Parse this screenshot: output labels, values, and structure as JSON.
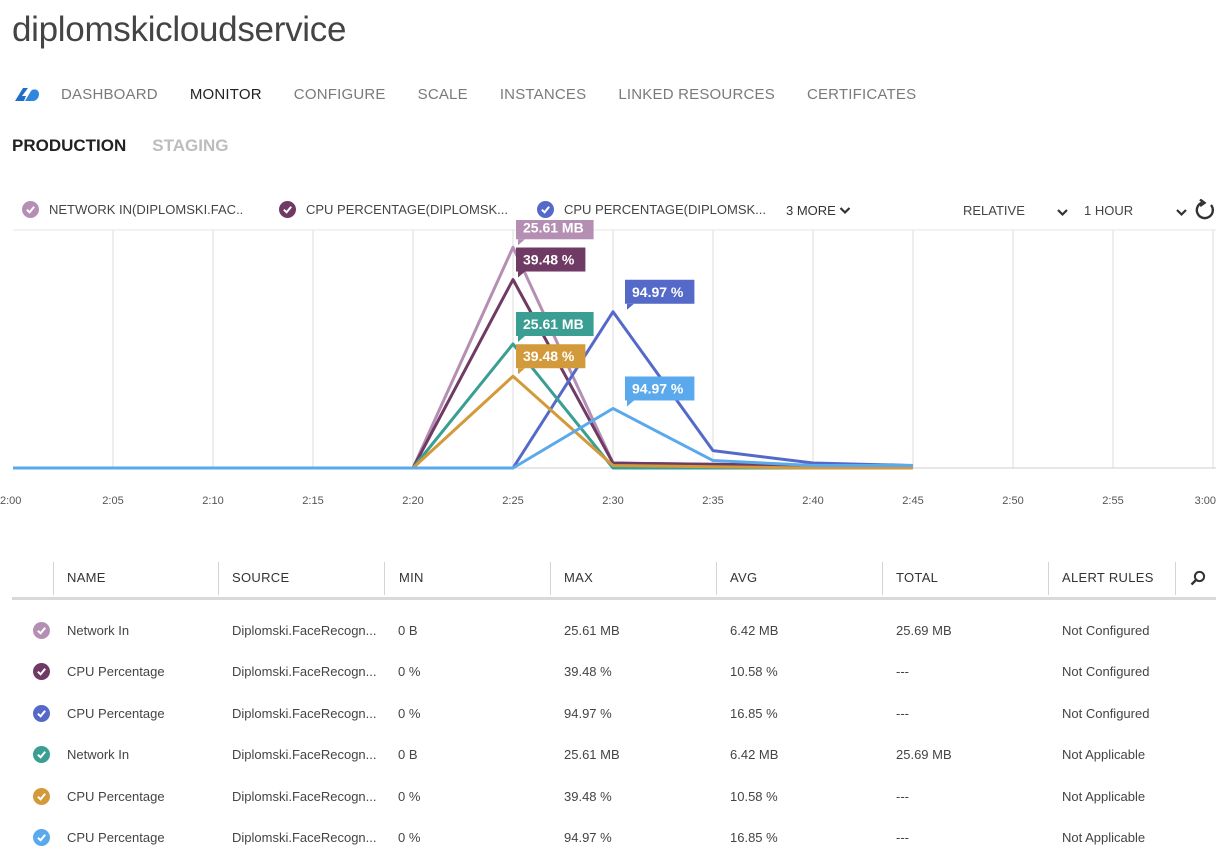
{
  "app": {
    "title": "diplomskicloudservice"
  },
  "nav": {
    "tabs": [
      "DASHBOARD",
      "MONITOR",
      "CONFIGURE",
      "SCALE",
      "INSTANCES",
      "LINKED RESOURCES",
      "CERTIFICATES"
    ],
    "active": "MONITOR"
  },
  "slots": {
    "production": "PRODUCTION",
    "staging": "STAGING"
  },
  "toolbar": {
    "legend": [
      {
        "label": "NETWORK IN(DIPLOMSKI.FAC..",
        "color": "#b48fb3"
      },
      {
        "label": "CPU PERCENTAGE(DIPLOMSK...",
        "color": "#6f3a63"
      },
      {
        "label": "CPU PERCENTAGE(DIPLOMSK...",
        "color": "#5569c9"
      }
    ],
    "more_label": "3 MORE",
    "mode_label": "RELATIVE",
    "range_label": "1 HOUR"
  },
  "chart_data": {
    "type": "line",
    "x": [
      "2:00",
      "2:05",
      "2:10",
      "2:15",
      "2:20",
      "2:25",
      "2:30",
      "2:35",
      "2:40",
      "2:45",
      "2:50",
      "2:55",
      "3:00"
    ],
    "series": [
      {
        "color": "#b48fb3",
        "points": [
          [
            "2:00",
            0
          ],
          [
            "2:20",
            0
          ],
          [
            "2:25",
            0.89
          ],
          [
            "2:30",
            0.02
          ],
          [
            "2:40",
            0.01
          ],
          [
            "2:45",
            0.01
          ]
        ]
      },
      {
        "color": "#6f3a63",
        "points": [
          [
            "2:00",
            0
          ],
          [
            "2:20",
            0
          ],
          [
            "2:25",
            0.76
          ],
          [
            "2:30",
            0.02
          ],
          [
            "2:40",
            0.01
          ],
          [
            "2:45",
            0.01
          ]
        ]
      },
      {
        "color": "#5569c9",
        "points": [
          [
            "2:00",
            0
          ],
          [
            "2:25",
            0
          ],
          [
            "2:30",
            0.63
          ],
          [
            "2:35",
            0.07
          ],
          [
            "2:40",
            0.02
          ],
          [
            "2:45",
            0.01
          ]
        ]
      },
      {
        "color": "#3a9e93",
        "points": [
          [
            "2:00",
            0
          ],
          [
            "2:20",
            0
          ],
          [
            "2:25",
            0.5
          ],
          [
            "2:30",
            0.0
          ],
          [
            "2:40",
            0.0
          ],
          [
            "2:45",
            0.0
          ]
        ]
      },
      {
        "color": "#d39a3c",
        "points": [
          [
            "2:00",
            0
          ],
          [
            "2:20",
            0
          ],
          [
            "2:25",
            0.37
          ],
          [
            "2:30",
            0.01
          ],
          [
            "2:40",
            0.0
          ],
          [
            "2:45",
            0.0
          ]
        ]
      },
      {
        "color": "#5aa9ec",
        "points": [
          [
            "2:00",
            0
          ],
          [
            "2:25",
            0
          ],
          [
            "2:30",
            0.24
          ],
          [
            "2:35",
            0.03
          ],
          [
            "2:40",
            0.01
          ],
          [
            "2:45",
            0.01
          ]
        ]
      }
    ],
    "tooltips": [
      {
        "text": "25.61 MB",
        "series": 0
      },
      {
        "text": "39.48 %",
        "series": 1
      },
      {
        "text": "94.97 %",
        "series": 2
      },
      {
        "text": "25.61 MB",
        "series": 3
      },
      {
        "text": "39.48 %",
        "series": 4
      },
      {
        "text": "94.97 %",
        "series": 5
      }
    ]
  },
  "table": {
    "columns": [
      "NAME",
      "SOURCE",
      "MIN",
      "MAX",
      "AVG",
      "TOTAL",
      "ALERT RULES"
    ],
    "rows": [
      {
        "color": "#b48fb3",
        "name": "Network In",
        "source": "Diplomski.FaceRecogn...",
        "min": "0 B",
        "max": "25.61 MB",
        "avg": "6.42 MB",
        "total": "25.69 MB",
        "alert": "Not Configured"
      },
      {
        "color": "#6f3a63",
        "name": "CPU Percentage",
        "source": "Diplomski.FaceRecogn...",
        "min": "0 %",
        "max": "39.48 %",
        "avg": "10.58 %",
        "total": "---",
        "alert": "Not Configured"
      },
      {
        "color": "#5569c9",
        "name": "CPU Percentage",
        "source": "Diplomski.FaceRecogn...",
        "min": "0 %",
        "max": "94.97 %",
        "avg": "16.85 %",
        "total": "---",
        "alert": "Not Configured"
      },
      {
        "color": "#3a9e93",
        "name": "Network In",
        "source": "Diplomski.FaceRecogn...",
        "min": "0 B",
        "max": "25.61 MB",
        "avg": "6.42 MB",
        "total": "25.69 MB",
        "alert": "Not Applicable"
      },
      {
        "color": "#d39a3c",
        "name": "CPU Percentage",
        "source": "Diplomski.FaceRecogn...",
        "min": "0 %",
        "max": "39.48 %",
        "avg": "10.58 %",
        "total": "---",
        "alert": "Not Applicable"
      },
      {
        "color": "#5aa9ec",
        "name": "CPU Percentage",
        "source": "Diplomski.FaceRecogn...",
        "min": "0 %",
        "max": "94.97 %",
        "avg": "16.85 %",
        "total": "---",
        "alert": "Not Applicable"
      }
    ]
  }
}
